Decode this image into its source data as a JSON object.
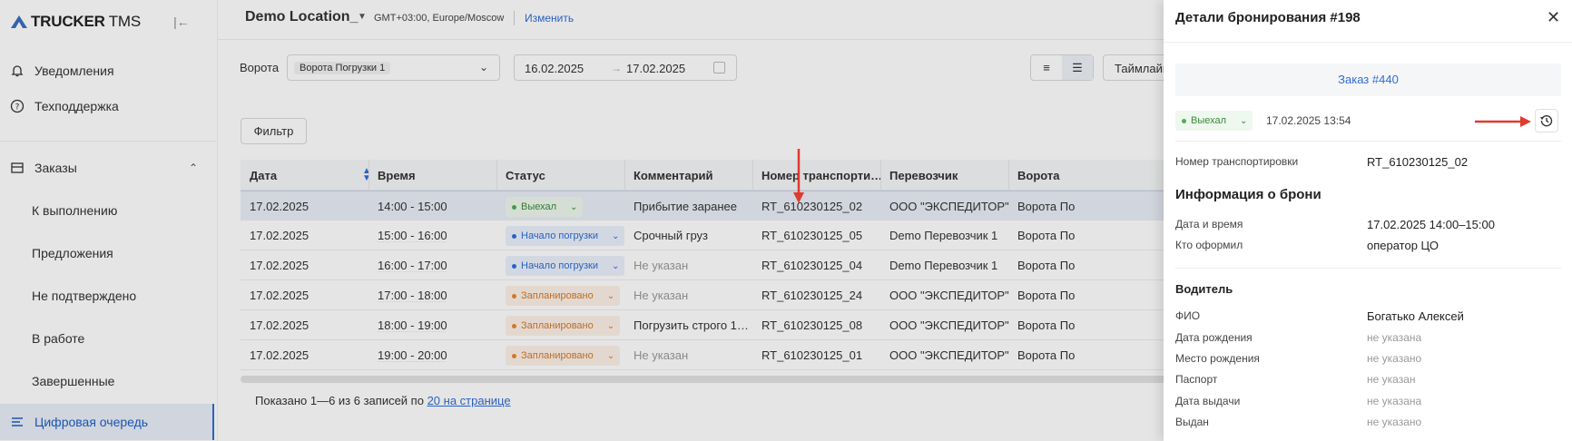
{
  "logo": {
    "brand": "TRUCKER",
    "suffix": "TMS"
  },
  "sidebar": {
    "notifications": "Уведомления",
    "support": "Техподдержка",
    "orders": "Заказы",
    "sub_items": [
      "К выполнению",
      "Предложения",
      "Не подтверждено",
      "В работе",
      "Завершенные"
    ],
    "digital_queue": "Цифровая очередь"
  },
  "topbar": {
    "location": "Demo Location_",
    "timezone": "GMT+03:00, Europe/Moscow",
    "change": "Изменить"
  },
  "filters": {
    "gate_label": "Ворота",
    "gate_value": "Ворота Погрузки 1",
    "date_from": "16.02.2025",
    "date_to": "17.02.2025",
    "timeline_label": "Таймлайн",
    "filter_button": "Фильтр"
  },
  "table": {
    "columns": [
      "Дата",
      "Время",
      "Статус",
      "Комментарий",
      "Номер транспорти…",
      "Перевозчик",
      "Ворота"
    ],
    "rows": [
      {
        "date": "17.02.2025",
        "time": "14:00 - 15:00",
        "status": "Выехал",
        "tone": "green",
        "comment": "Прибытие заранее",
        "number": "RT_610230125_02",
        "carrier": "ООО \"ЭКСПЕДИТОР\"",
        "gate": "Ворота По"
      },
      {
        "date": "17.02.2025",
        "time": "15:00 - 16:00",
        "status": "Начало погрузки",
        "tone": "blue",
        "comment": "Срочный груз",
        "number": "RT_610230125_05",
        "carrier": "Demo Перевозчик 1",
        "gate": "Ворота По"
      },
      {
        "date": "17.02.2025",
        "time": "16:00 - 17:00",
        "status": "Начало погрузки",
        "tone": "blue",
        "comment": "Не указан",
        "number": "RT_610230125_04",
        "carrier": "Demo Перевозчик 1",
        "gate": "Ворота По"
      },
      {
        "date": "17.02.2025",
        "time": "17:00 - 18:00",
        "status": "Запланировано",
        "tone": "orange",
        "comment": "Не указан",
        "number": "RT_610230125_24",
        "carrier": "ООО \"ЭКСПЕДИТОР\"",
        "gate": "Ворота По"
      },
      {
        "date": "17.02.2025",
        "time": "18:00 - 19:00",
        "status": "Запланировано",
        "tone": "orange",
        "comment": "Погрузить строго 1…",
        "number": "RT_610230125_08",
        "carrier": "ООО \"ЭКСПЕДИТОР\"",
        "gate": "Ворота По"
      },
      {
        "date": "17.02.2025",
        "time": "19:00 - 20:00",
        "status": "Запланировано",
        "tone": "orange",
        "comment": "Не указан",
        "number": "RT_610230125_01",
        "carrier": "ООО \"ЭКСПЕДИТОР\"",
        "gate": "Ворота По"
      }
    ],
    "pager_text": "Показано 1—6 из 6 записей по ",
    "pager_link": "20 на странице"
  },
  "drawer": {
    "title": "Детали бронирования #198",
    "order_link": "Заказ #440",
    "status": "Выехал",
    "status_time": "17.02.2025 13:54",
    "transport_label": "Номер транспортировки",
    "transport_value": "RT_610230125_02",
    "booking_section": "Информация о брони",
    "datetime_label": "Дата и время",
    "datetime_value": "17.02.2025 14:00–15:00",
    "issued_by_label": "Кто оформил",
    "issued_by_value": "оператор ЦО",
    "driver_section": "Водитель",
    "driver": [
      {
        "label": "ФИО",
        "value": "Богатько Алексей",
        "muted": false
      },
      {
        "label": "Дата рождения",
        "value": "не указана",
        "muted": true
      },
      {
        "label": "Место рождения",
        "value": "не указано",
        "muted": true
      },
      {
        "label": "Паспорт",
        "value": "не указан",
        "muted": true
      },
      {
        "label": "Дата выдачи",
        "value": "не указана",
        "muted": true
      },
      {
        "label": "Выдан",
        "value": "не указано",
        "muted": true
      }
    ]
  },
  "colors": {
    "accent": "#2f6ed5",
    "annotation": "#e03a2f"
  }
}
